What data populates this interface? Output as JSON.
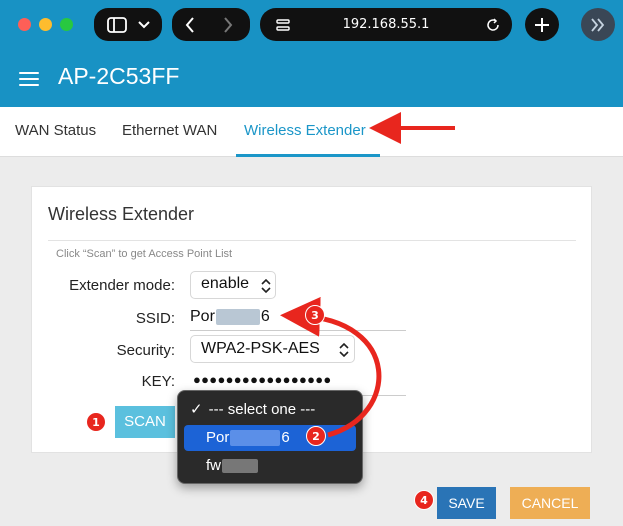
{
  "browser": {
    "url": "192.168.55.1"
  },
  "header": {
    "title": "AP-2C53FF"
  },
  "tabs": [
    {
      "label": "WAN Status"
    },
    {
      "label": "Ethernet WAN"
    },
    {
      "label": "Wireless Extender"
    }
  ],
  "card": {
    "title": "Wireless Extender",
    "hint": "Click “Scan” to get Access Point List",
    "extender_mode": {
      "label": "Extender mode:",
      "value": "enable"
    },
    "ssid": {
      "label": "SSID:",
      "value_start": "Por",
      "value_end": "6"
    },
    "security": {
      "label": "Security:",
      "value": "WPA2-PSK-AES"
    },
    "key": {
      "label": "KEY:",
      "value": "●●●●●●●●●●●●●●●●●"
    },
    "scan_label": "SCAN"
  },
  "dropdown": {
    "items": [
      {
        "label": "--- select one ---"
      },
      {
        "label_start": "Por",
        "label_end": "6"
      },
      {
        "label_start": "fw"
      }
    ]
  },
  "footer": {
    "save_label": "SAVE",
    "cancel_label": "CANCEL"
  },
  "annotations": {
    "b1": "1",
    "b2": "2",
    "b3": "3",
    "b4": "4"
  },
  "colors": {
    "brand": "#1892c4",
    "accent": "#1b96c8",
    "annotation": "#e8261e"
  }
}
